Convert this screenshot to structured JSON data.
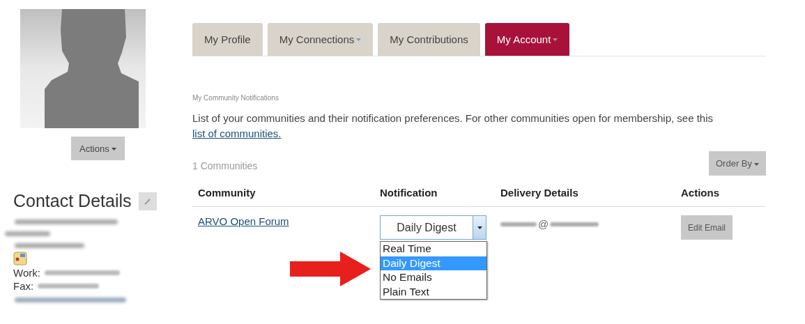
{
  "profile": {
    "actions_button": "Actions"
  },
  "contact": {
    "heading": "Contact Details",
    "fields": [
      {
        "label": "Work:"
      },
      {
        "label": "Fax:"
      }
    ]
  },
  "tabs": [
    {
      "label": "My Profile",
      "dropdown": false,
      "selected": false
    },
    {
      "label": "My Connections",
      "dropdown": true,
      "selected": false
    },
    {
      "label": "My Contributions",
      "dropdown": false,
      "selected": false
    },
    {
      "label": "My Account",
      "dropdown": true,
      "selected": true
    }
  ],
  "notifications": {
    "title": "My Community Notifications",
    "intro": "List of your communities and their notification preferences. For other communities open for membership, see this",
    "link": "list of communities.",
    "count": "1 Communities",
    "order_button": "Order By",
    "columns": [
      "Community",
      "Notification",
      "Delivery Details",
      "Actions"
    ],
    "rows": [
      {
        "community": "ARVO Open Forum",
        "notification": {
          "value": "Daily Digest",
          "expanded": true,
          "options": [
            {
              "label": "Real Time",
              "selected": false
            },
            {
              "label": "Daily Digest",
              "selected": true
            },
            {
              "label": "No Emails",
              "selected": false
            },
            {
              "label": "Plain Text",
              "selected": false
            }
          ]
        },
        "delivery": "@",
        "action": "Edit Email"
      }
    ]
  }
}
